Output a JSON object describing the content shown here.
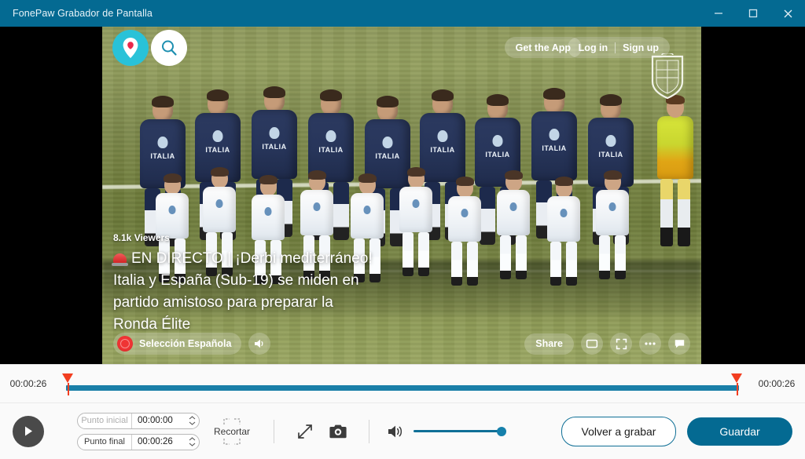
{
  "window": {
    "title": "FonePaw Grabador de Pantalla",
    "accent_color": "#046a92",
    "controls": {
      "minimize": "minimize-icon",
      "maximize": "maximize-icon",
      "close": "close-icon"
    }
  },
  "preview": {
    "overlay": {
      "logo_icon": "periscope-logo-icon",
      "search_icon": "search-icon",
      "get_app_label": "Get the App",
      "login_label": "Log in",
      "signup_label": "Sign up",
      "crest_icon": "spain-federation-crest-icon",
      "viewers": "8.1k Viewers",
      "description_line1": "EN DIRECTO | ¡Derbi mediterráneo!",
      "description_line2": "Italia y España (Sub-19) se miden en",
      "description_line3": "partido amistoso para preparar la",
      "description_line4": "Ronda Élite",
      "broadcaster": "Selección Española",
      "mute_icon": "speaker-icon",
      "share_label": "Share",
      "pip_icon": "picture-in-picture-icon",
      "fullscreen_icon": "fullscreen-icon",
      "more_icon": "more-options-icon",
      "chat_icon": "chat-icon"
    },
    "video": {
      "jersey_text": "ITALIA"
    }
  },
  "timeline": {
    "start_time": "00:00:26",
    "end_time": "00:00:26",
    "track_color": "#1a7fa8",
    "marker_color": "#f23e20"
  },
  "controls": {
    "play_icon": "play-icon",
    "start_point_label": "Punto inicial",
    "start_point_value": "00:00:00",
    "end_point_label": "Punto final",
    "end_point_value": "00:00:26",
    "crop_label": "Recortar",
    "resize_icon": "resize-icon",
    "snapshot_icon": "camera-icon",
    "volume_icon": "volume-icon",
    "volume_level": 100,
    "rerecord_label": "Volver a grabar",
    "save_label": "Guardar"
  }
}
